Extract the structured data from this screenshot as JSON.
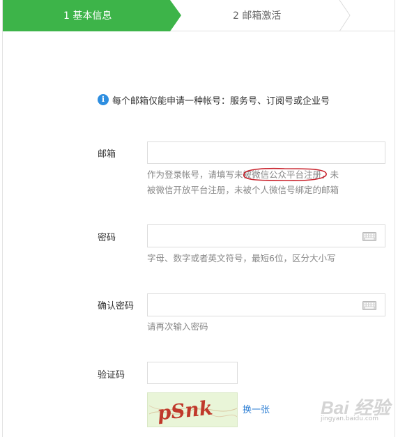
{
  "steps": [
    {
      "label": "1 基本信息",
      "active": true
    },
    {
      "label": "2 邮箱激活",
      "active": false
    }
  ],
  "colors": {
    "active_step": "#3db449",
    "link": "#2e7fd4",
    "info": "#2e8ee0"
  },
  "notice": {
    "icon": "info-icon",
    "text": "每个邮箱仅能申请一种帐号：服务号、订阅号或企业号"
  },
  "form": {
    "email": {
      "label": "邮箱",
      "value": "",
      "hint_line1_a": "作为登录帐号，请填写",
      "hint_line1_b": "未被微信公众平台注册",
      "hint_line1_c": "，未",
      "hint_line2": "被微信开放平台注册，未被个人微信号绑定的邮箱"
    },
    "password": {
      "label": "密码",
      "value": "",
      "icon": "keyboard-icon",
      "hint": "字母、数字或者英文符号，最短6位，区分大小写"
    },
    "confirm": {
      "label": "确认密码",
      "value": "",
      "icon": "keyboard-icon",
      "hint": "请再次输入密码"
    },
    "captcha": {
      "label": "验证码",
      "value": "",
      "image_text": "pSnk",
      "refresh": "换一张"
    }
  },
  "watermark": {
    "main": "Bai 经验",
    "sub": "jingyan.baidu.com"
  }
}
